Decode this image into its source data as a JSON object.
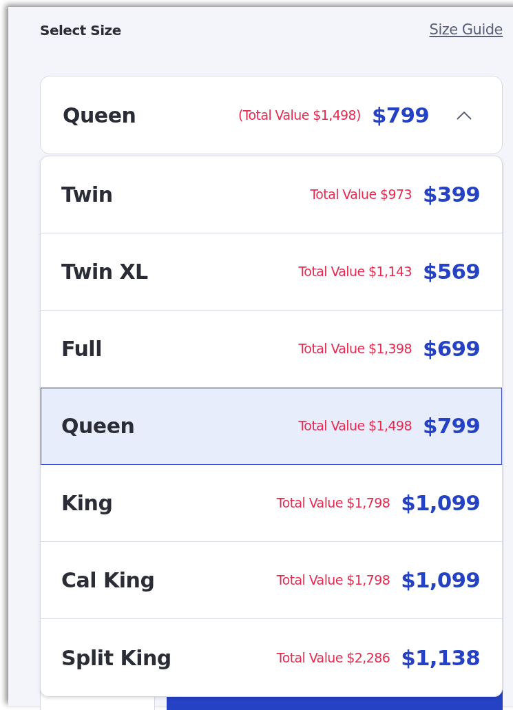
{
  "header": {
    "title": "Select Size",
    "link": "Size Guide"
  },
  "select": {
    "label": "Queen",
    "total_value": "(Total Value $1,498)",
    "price": "$799",
    "expanded": true
  },
  "options": [
    {
      "label": "Twin",
      "total_value": "Total Value $973",
      "price": "$399",
      "selected": false
    },
    {
      "label": "Twin XL",
      "total_value": "Total Value $1,143",
      "price": "$569",
      "selected": false
    },
    {
      "label": "Full",
      "total_value": "Total Value $1,398",
      "price": "$699",
      "selected": false
    },
    {
      "label": "Queen",
      "total_value": "Total Value $1,498",
      "price": "$799",
      "selected": true
    },
    {
      "label": "King",
      "total_value": "Total Value $1,798",
      "price": "$1,099",
      "selected": false
    },
    {
      "label": "Cal King",
      "total_value": "Total Value $1,798",
      "price": "$1,099",
      "selected": false
    },
    {
      "label": "Split King",
      "total_value": "Total Value $2,286",
      "price": "$1,138",
      "selected": false
    }
  ]
}
